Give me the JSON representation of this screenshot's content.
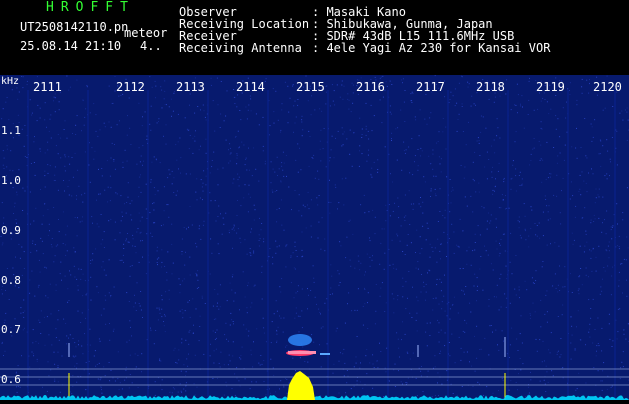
{
  "header": {
    "app_name": "HROFFT",
    "filename": "UT2508142110.pn",
    "tag": "meteor",
    "timestamp": "25.08.14 21:10",
    "status": "4..",
    "info_labels": [
      "Observer",
      "Receiving Location",
      "Receiver",
      "Receiving Antenna"
    ],
    "info_values": [
      ": Masaki Kano",
      ": Shibukawa, Gunma, Japan",
      ": SDR# 43dB L15 111.6MHz USB",
      ": 4ele Yagi Az 230 for Kansai VOR"
    ]
  },
  "axis": {
    "unit": "kHz",
    "x_ticks": [
      "2111",
      "2112",
      "2113",
      "2114",
      "2115",
      "2116",
      "2117",
      "2118",
      "2119",
      "2120"
    ],
    "y_ticks": [
      "1.1",
      "1.0",
      "0.9",
      "0.8",
      "0.7",
      "0.6"
    ]
  },
  "colors": {
    "background": "#071a6e",
    "noise": "#2a45c8",
    "signal_bright": "#ffff00",
    "signal_hot": "#ff3a6a",
    "spectrum": "#00d8ff",
    "header_accent": "#33ff33"
  }
}
